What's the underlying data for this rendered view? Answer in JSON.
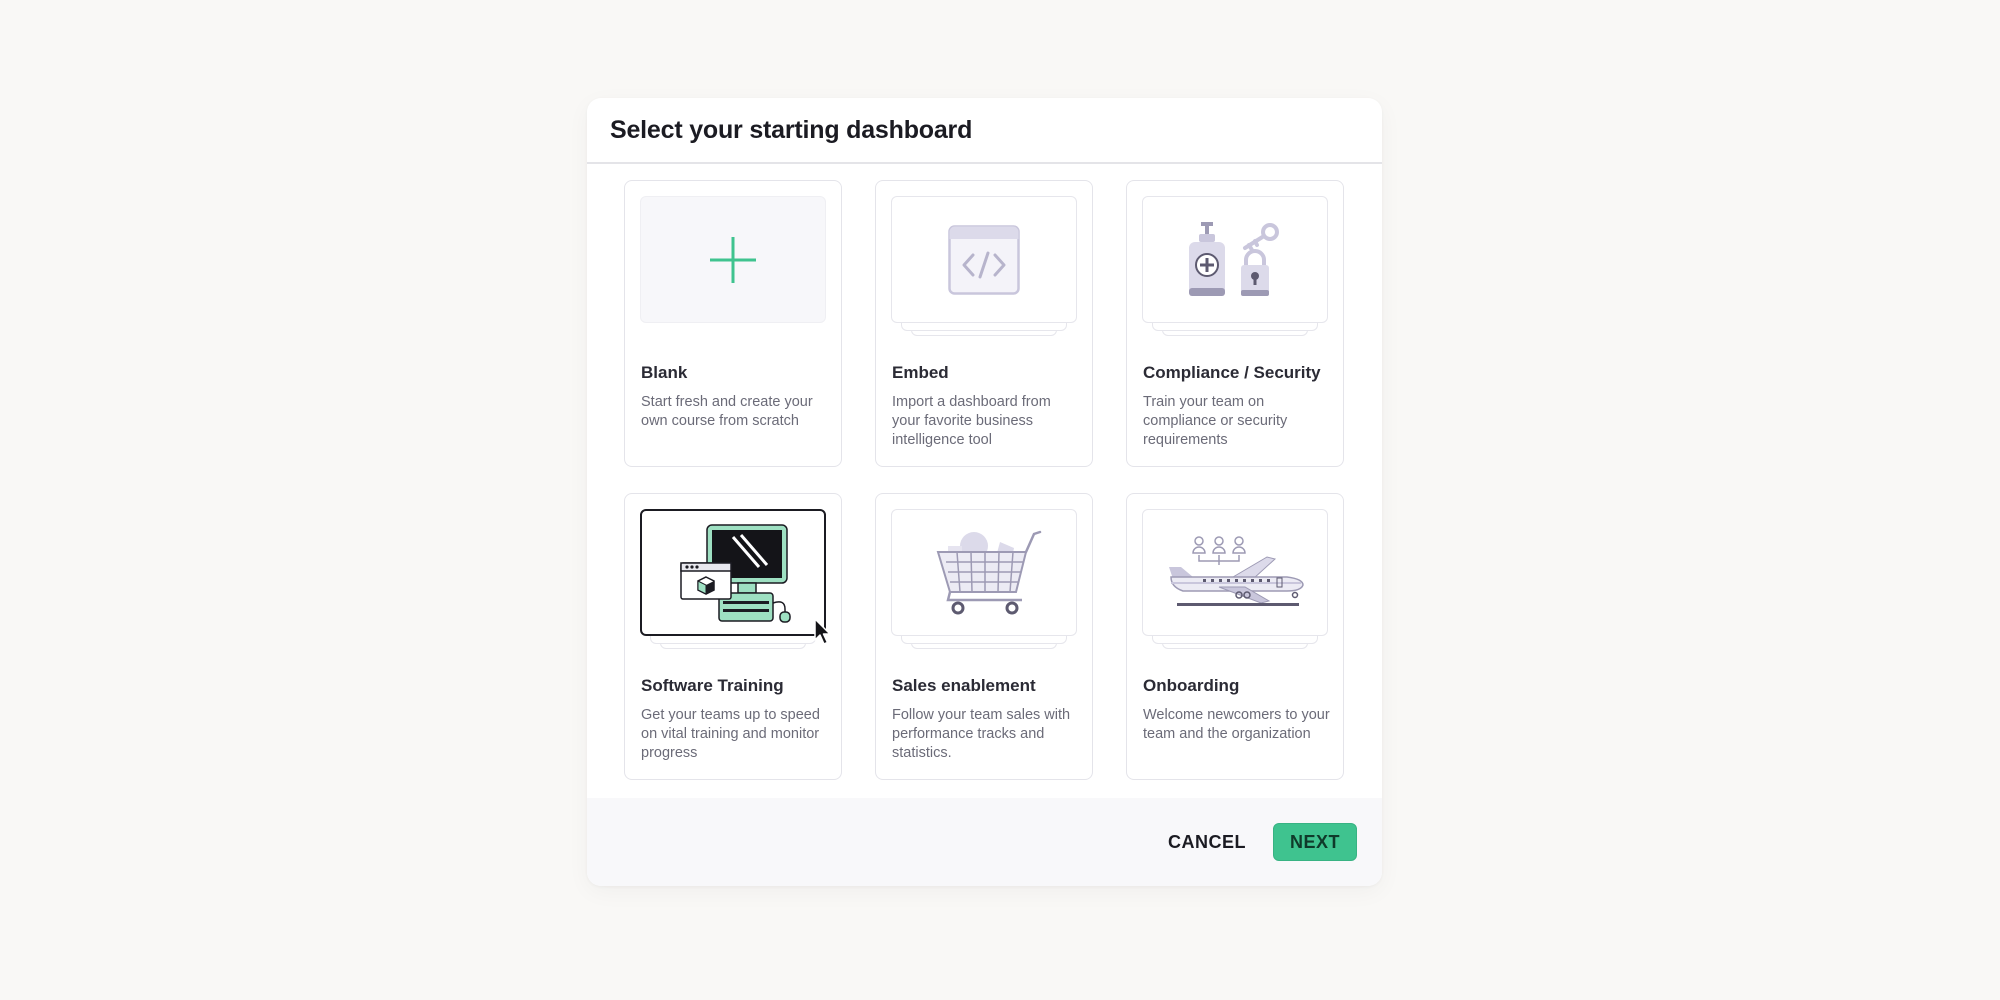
{
  "modal": {
    "title": "Select your starting dashboard"
  },
  "cards": [
    {
      "title": "Blank",
      "description": "Start fresh and create your own course from scratch",
      "icon": "plus-icon"
    },
    {
      "title": "Embed",
      "description": "Import a dashboard from your favorite business intelligence tool",
      "icon": "code-window-icon"
    },
    {
      "title": "Compliance / Security",
      "description": "Train your team on compliance or security requirements",
      "icon": "security-illustration"
    },
    {
      "title": "Software Training",
      "description": "Get your teams up to speed on vital training and monitor progress",
      "icon": "computer-illustration",
      "selected": true
    },
    {
      "title": "Sales enablement",
      "description": "Follow your team sales with performance tracks and statistics.",
      "icon": "shopping-cart-illustration"
    },
    {
      "title": "Onboarding",
      "description": "Welcome newcomers to your team and the organization",
      "icon": "airplane-illustration"
    }
  ],
  "footer": {
    "cancel_label": "CANCEL",
    "next_label": "NEXT"
  },
  "colors": {
    "accent": "#3fc38f",
    "accent_light": "#9ee0c2",
    "illustration_purple": "#c9c6dc",
    "background": "#f9f8f6"
  }
}
